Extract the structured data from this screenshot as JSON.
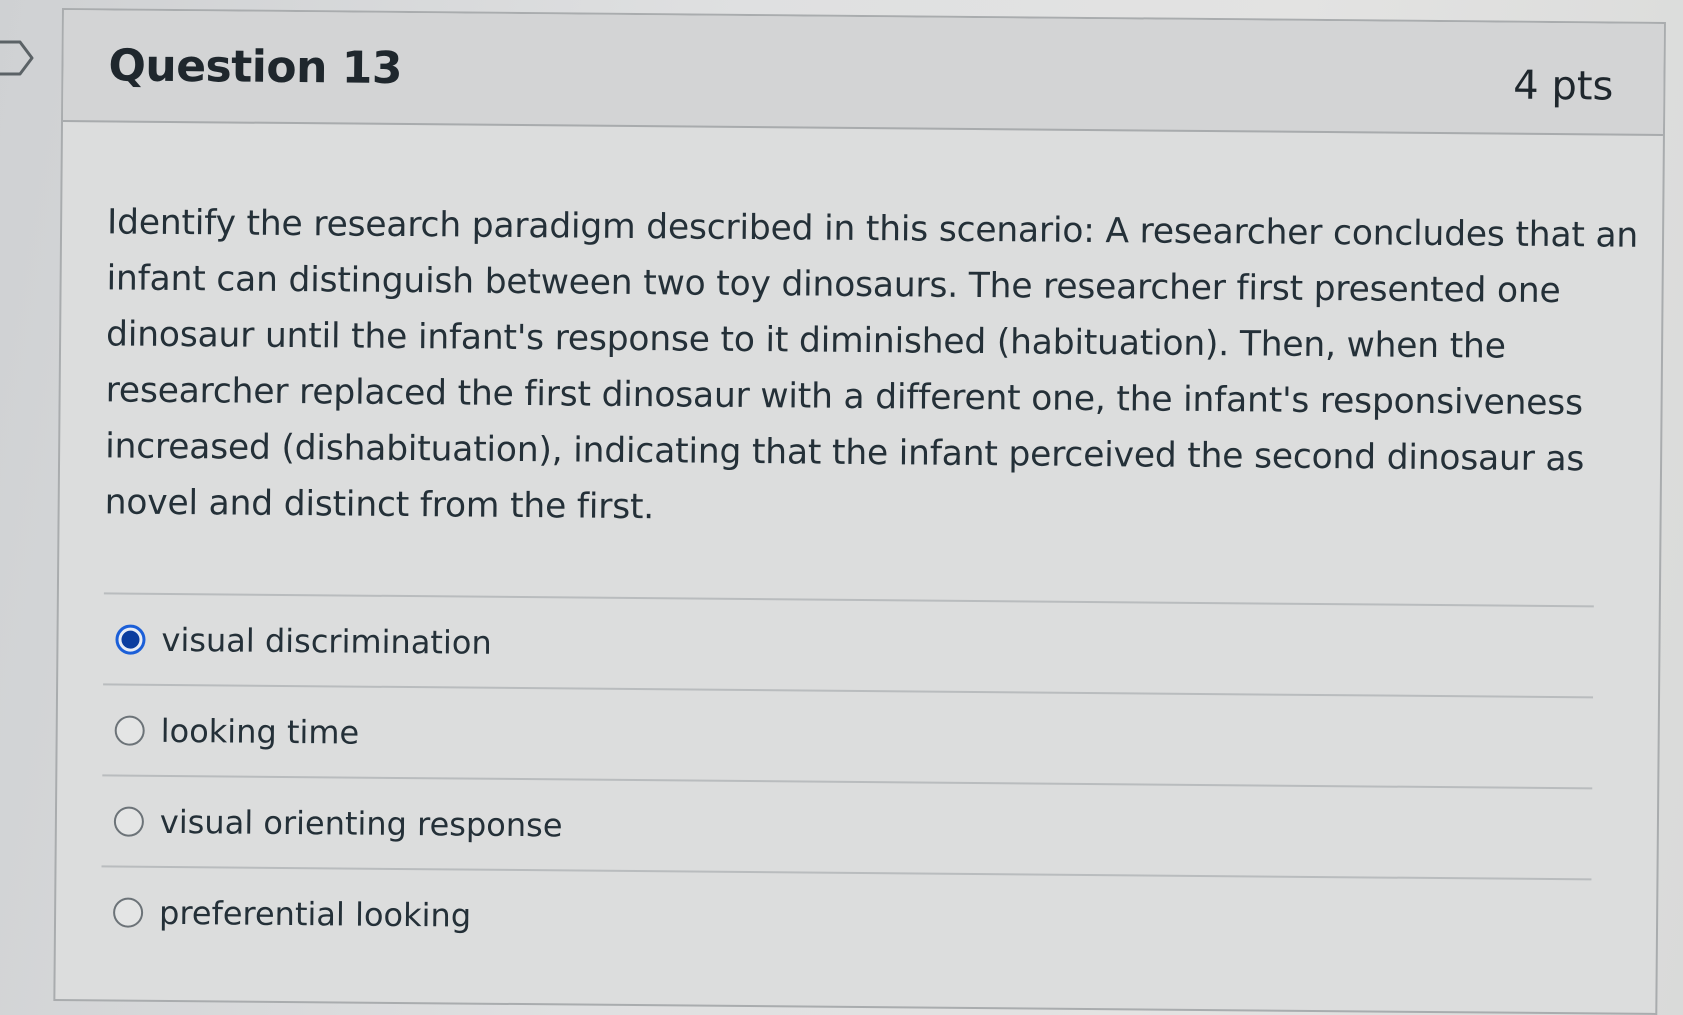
{
  "question": {
    "title": "Question 13",
    "points": "4 pts",
    "text": "Identify the research paradigm described in this scenario: A researcher concludes that an infant can distinguish between two toy dinosaurs. The researcher first presented one dinosaur until the infant's response to it diminished (habituation). Then, when the researcher replaced the first dinosaur with a different one, the infant's responsiveness increased (dishabituation), indicating that the infant perceived the second dinosaur as novel and distinct from the first.",
    "answers": [
      {
        "label": "visual discrimination",
        "selected": true
      },
      {
        "label": "looking time",
        "selected": false
      },
      {
        "label": "visual orienting response",
        "selected": false
      },
      {
        "label": "preferential looking",
        "selected": false
      }
    ]
  },
  "colors": {
    "accent": "#1b5fd8",
    "selected_dot": "#0b3d9f",
    "text": "#243038"
  },
  "icons": {
    "flag": "flag-outline-icon",
    "radio_selected": "radio-selected-icon",
    "radio_unselected": "radio-unselected-icon"
  }
}
